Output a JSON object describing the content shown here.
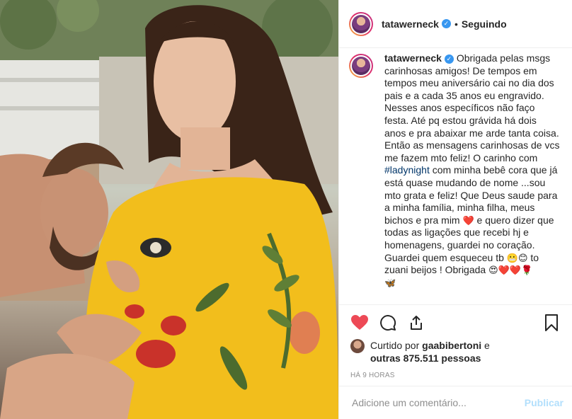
{
  "post": {
    "username": "tatawerneck",
    "verified_icon": "verified-badge-icon",
    "follow_status": "Seguindo",
    "separator": "•"
  },
  "caption": {
    "part1": "Obrigada pelas msgs carinhosas amigos! De tempos em tempos meu aniversário cai no dia dos pais e a cada 35 anos eu engravido. Nesses anos específicos não faço festa. Até pq estou grávida há dois anos e pra abaixar me arde tanta coisa. Então as mensagens carinhosas de vcs me fazem mto feliz! O carinho com ",
    "hashtag": "#ladynight",
    "part2": " com minha bebê cora que já está quase mudando de nome ...sou mto grata e feliz! Que Deus saude para a minha família, minha filha, meus bichos e pra mim ",
    "emoji1": "❤️",
    "part3": " e quero dizer que todas as ligações que recebi hj e homenagens, guardei no coração. Guardei quem esqueceu tb ",
    "emoji2": "😬😊",
    "part4": " to zuani beijos ! Obrigada ",
    "emoji3": "😍❤️❤️🌹",
    "emoji4": "🦋"
  },
  "actions": {
    "like_icon": "heart-filled-icon",
    "comment_icon": "comment-icon",
    "share_icon": "share-icon",
    "save_icon": "bookmark-icon",
    "like_color": "#ed4956"
  },
  "likes": {
    "prefix": "Curtido por ",
    "user": "gaabibertoni",
    "conj": " e",
    "others": "outras 875.511 pessoas"
  },
  "timestamp": "HÁ 9 HORAS",
  "comment_box": {
    "placeholder": "Adicione um comentário...",
    "publish_label": "Publicar"
  }
}
